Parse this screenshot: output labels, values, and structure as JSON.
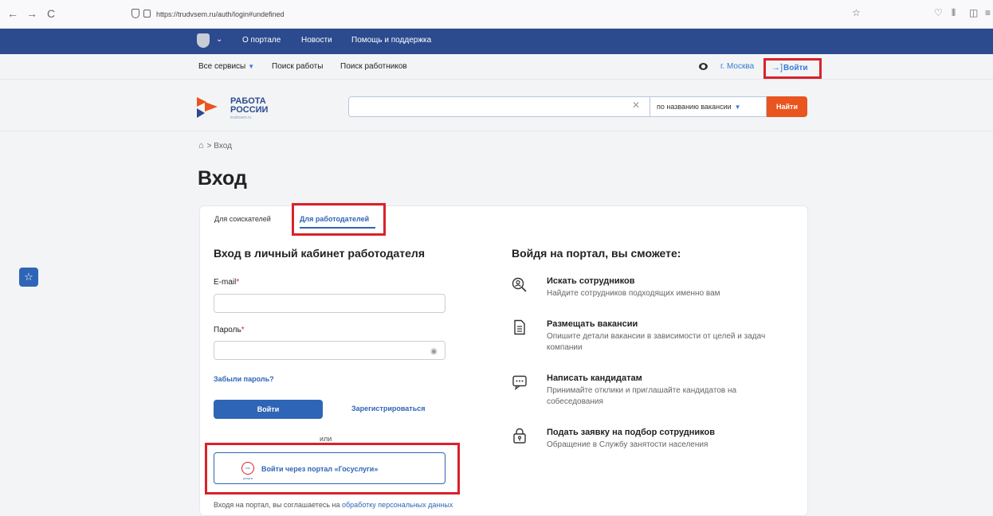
{
  "browser": {
    "url": "https://trudvsem.ru/auth/login#undefined",
    "back": "←",
    "forward": "→",
    "reload": "C"
  },
  "topnav": {
    "items": [
      "О портале",
      "Новости",
      "Помощь и поддержка"
    ]
  },
  "service_bar": {
    "all_services": "Все сервисы",
    "job_search": "Поиск работы",
    "employee_search": "Поиск работников",
    "city": "г. Москва",
    "login": "Войти"
  },
  "header": {
    "logo_line1": "РАБОТА",
    "logo_line2": "РОССИИ",
    "logo_sub": "trudvsem.ru",
    "search_value": "",
    "search_mode": "по названию вакансии",
    "search_button": "Найти"
  },
  "breadcrumb": {
    "current": "Вход"
  },
  "page_title": "Вход",
  "tabs": [
    "Для соискателей",
    "Для работодателей"
  ],
  "form": {
    "title": "Вход в личный кабинет работодателя",
    "email_label": "E-mail",
    "password_label": "Пароль",
    "required_mark": "*",
    "forgot": "Забыли пароль?",
    "submit": "Войти",
    "register": "Зарегистрироваться",
    "or": "или",
    "gosuslugi": "Войти через портал «Госуслуги»",
    "gos_icon_text": "гос услуги",
    "agree_prefix": "Входя на портал, вы соглашаетесь на",
    "agree_link": "обработку персональных данных"
  },
  "info": {
    "title": "Войдя на портал, вы сможете:",
    "features": [
      {
        "title": "Искать сотрудников",
        "desc": "Найдите сотрудников подходящих именно вам"
      },
      {
        "title": "Размещать вакансии",
        "desc": "Опишите детали вакансии в зависимости от целей и задач компании"
      },
      {
        "title": "Написать кандидатам",
        "desc": "Принимайте отклики и приглашайте кандидатов на собеседования"
      },
      {
        "title": "Подать заявку на подбор сотрудников",
        "desc": "Обращение в Службу занятости населения"
      }
    ]
  }
}
